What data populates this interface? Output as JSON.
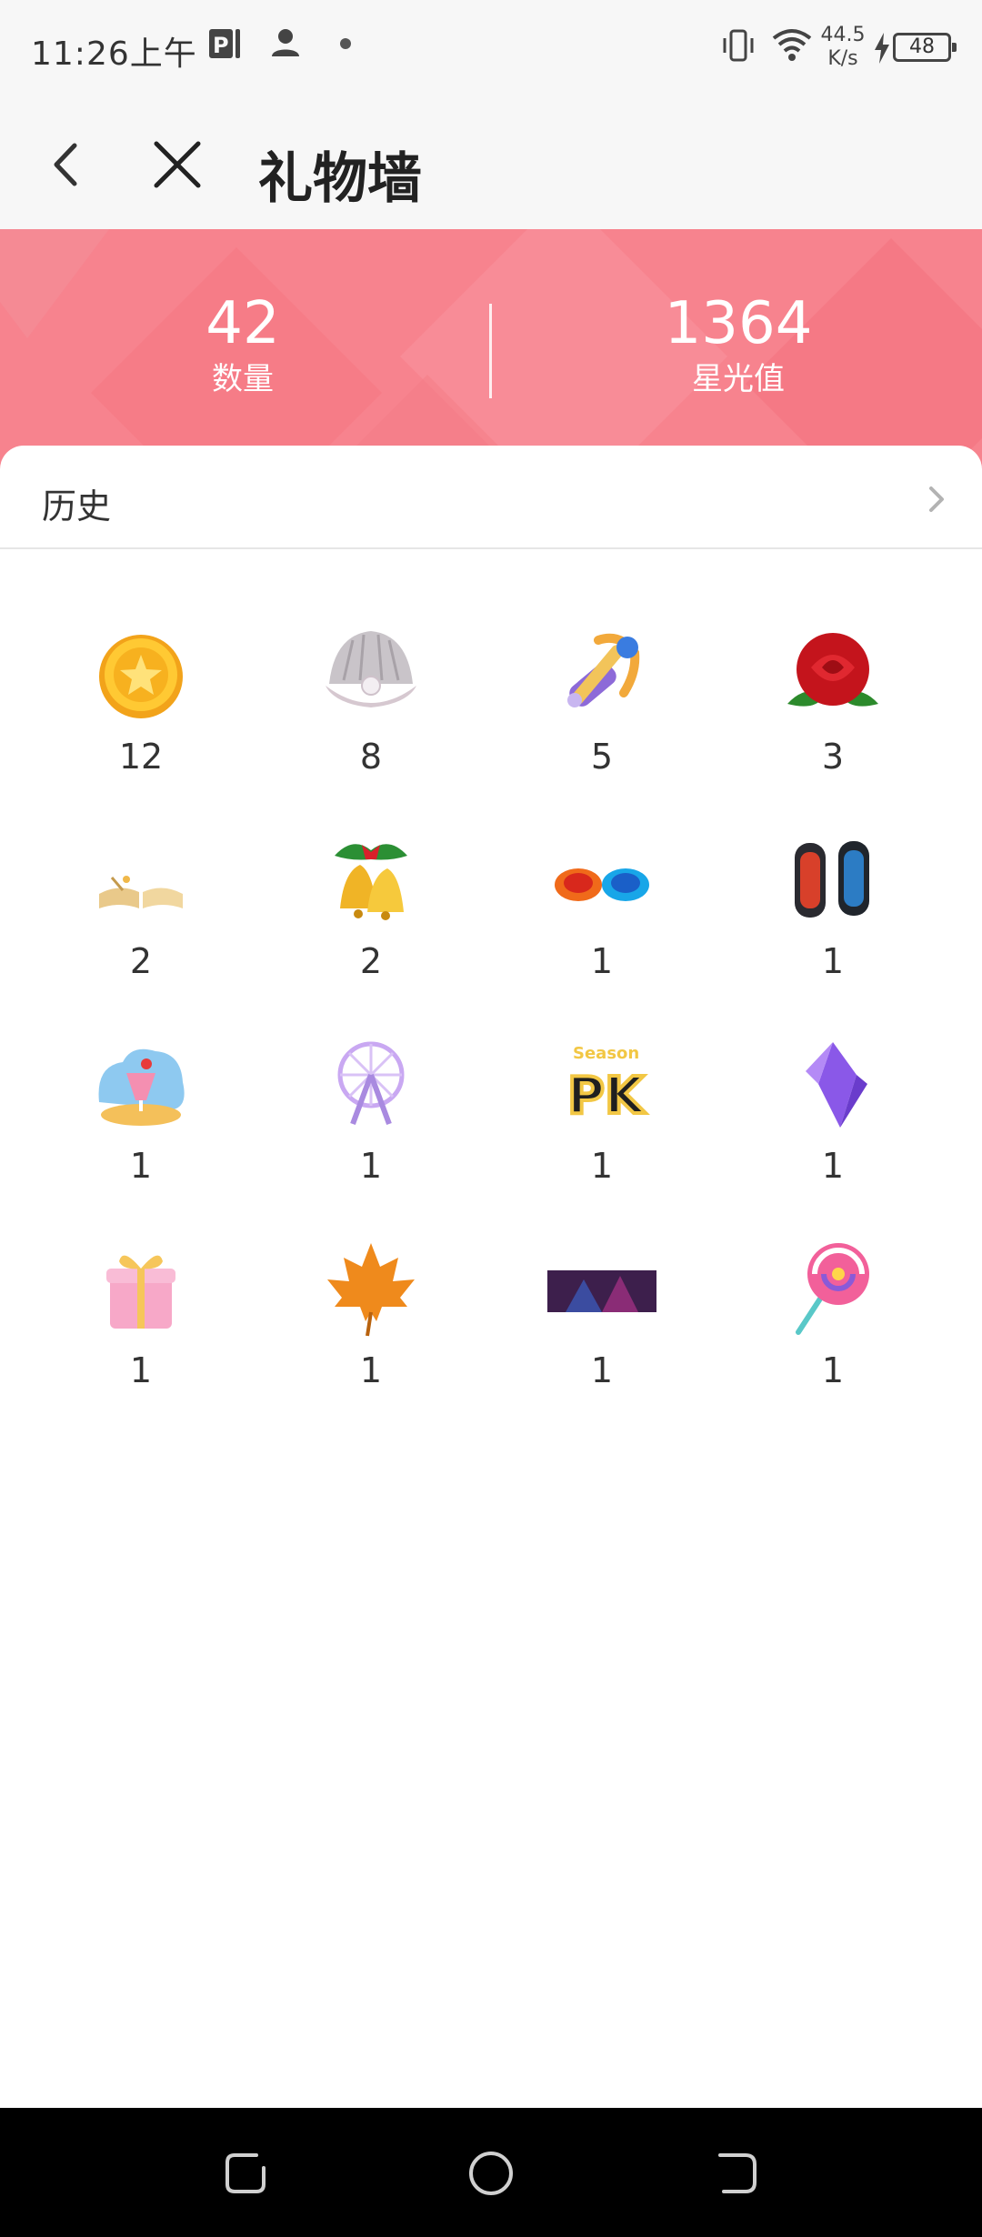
{
  "status_bar": {
    "time": "11:26上午",
    "speed_top": "44.5",
    "speed_bottom": "K/s",
    "battery": "48",
    "icons": [
      "parking-app-icon",
      "person-icon",
      "dot-icon",
      "vibrate-icon",
      "wifi-icon",
      "charging-icon"
    ]
  },
  "app_bar": {
    "title": "礼物墙",
    "icons": [
      "back-arrow-icon",
      "close-icon"
    ]
  },
  "stats": {
    "count_value": "42",
    "count_label": "数量",
    "starlight_value": "1364",
    "starlight_label": "星光值"
  },
  "history": {
    "label": "历史",
    "icon": "chevron-right-icon"
  },
  "gifts": [
    {
      "icon": "gold-star-coin-icon",
      "count": "12"
    },
    {
      "icon": "pearl-shell-icon",
      "count": "8"
    },
    {
      "icon": "magic-hammer-icon",
      "count": "5"
    },
    {
      "icon": "red-rose-icon",
      "count": "3"
    },
    {
      "icon": "open-book-icon",
      "count": "2"
    },
    {
      "icon": "christmas-bells-icon",
      "count": "2"
    },
    {
      "icon": "fire-ice-fists-icon",
      "count": "1"
    },
    {
      "icon": "race-cars-icon",
      "count": "1"
    },
    {
      "icon": "beach-drink-icon",
      "count": "1"
    },
    {
      "icon": "ferris-wheel-icon",
      "count": "1"
    },
    {
      "icon": "season-pk-icon",
      "count": "1"
    },
    {
      "icon": "purple-crystal-icon",
      "count": "1"
    },
    {
      "icon": "pink-gift-box-icon",
      "count": "1"
    },
    {
      "icon": "maple-leaf-icon",
      "count": "1"
    },
    {
      "icon": "concert-stage-icon",
      "count": "1"
    },
    {
      "icon": "lollipop-icon",
      "count": "1"
    }
  ],
  "colors": {
    "banner": "#f7838e",
    "banner_dark": "#f2707c",
    "status_bg": "#f7f7f7"
  },
  "nav_bar": {
    "icons": [
      "recent-apps-icon",
      "home-icon",
      "back-icon"
    ]
  }
}
